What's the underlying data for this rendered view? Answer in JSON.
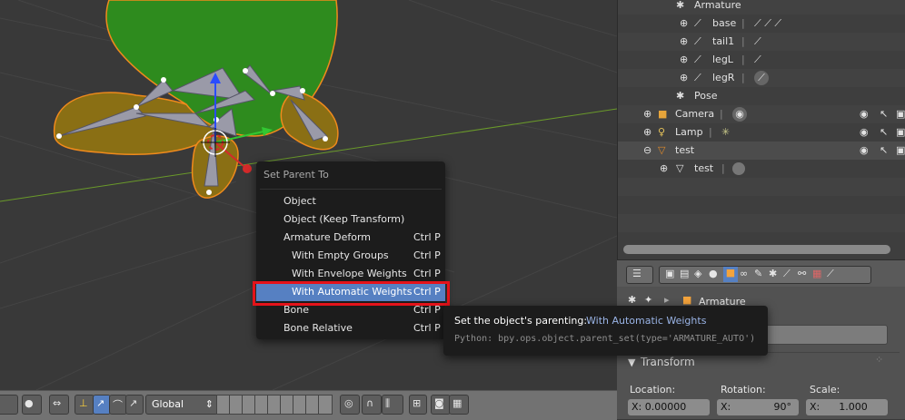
{
  "viewport": {
    "header": {
      "orientation_value": "Global"
    }
  },
  "outliner": {
    "rows": [
      {
        "label": "Armature",
        "icon": "armature-data-icon"
      },
      {
        "label": "base",
        "icon": "bone-icon"
      },
      {
        "label": "tail1",
        "icon": "bone-icon"
      },
      {
        "label": "legL",
        "icon": "bone-icon"
      },
      {
        "label": "legR",
        "icon": "bone-icon"
      },
      {
        "label": "Pose",
        "icon": "pose-icon"
      },
      {
        "label": "Camera",
        "icon": "camera-icon"
      },
      {
        "label": "Lamp",
        "icon": "lamp-icon"
      },
      {
        "label": "test",
        "icon": "mesh-object-icon"
      },
      {
        "label": "test",
        "icon": "mesh-data-icon"
      }
    ]
  },
  "menu": {
    "title": "Set Parent To",
    "items": [
      {
        "label": "Object",
        "shortcut": ""
      },
      {
        "label": "Object (Keep Transform)",
        "shortcut": ""
      },
      {
        "label": "Armature Deform",
        "shortcut": "Ctrl P"
      },
      {
        "label": "With Empty Groups",
        "shortcut": "Ctrl P"
      },
      {
        "label": "With Envelope Weights",
        "shortcut": "Ctrl P"
      },
      {
        "label": "With Automatic Weights",
        "shortcut": "Ctrl P"
      },
      {
        "label": "Bone",
        "shortcut": "Ctrl P"
      },
      {
        "label": "Bone Relative",
        "shortcut": "Ctrl P"
      }
    ]
  },
  "tooltip": {
    "description": "Set the object's parenting:",
    "value": "With Automatic Weights",
    "python": "Python: bpy.ops.object.parent_set(type='ARMATURE_AUTO')"
  },
  "properties": {
    "context": "Armature",
    "panel_title": "Transform",
    "location_label": "Location:",
    "rotation_label": "Rotation:",
    "scale_label": "Scale:",
    "location_x": "X: 0.00000",
    "rotation_x_label": "X:",
    "rotation_x_value": "90°",
    "scale_x": "X:      1.000"
  },
  "colors": {
    "menu_highlight": "#5680c2",
    "annotation_box": "#e4131a",
    "turtle_green": "#2e8b1e",
    "selection_outline": "#f08a1c"
  }
}
